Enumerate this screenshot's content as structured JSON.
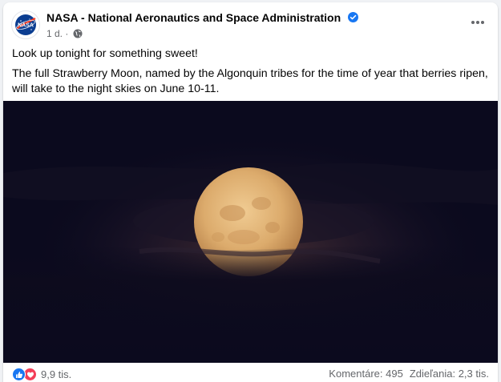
{
  "post": {
    "author": "NASA - National Aeronautics and Space Administration",
    "avatar_text": "NASA",
    "time": "1 d.",
    "time_sep": "·",
    "icons": {
      "verified": "verified-badge-icon",
      "audience": "globe-icon",
      "more": "more-options-icon"
    },
    "text_line1": "Look up tonight for something sweet!",
    "text_line2": "The full Strawberry Moon, named by the Algonquin tribes for the time of year that berries ripen, will take to the night skies on June 10-11."
  },
  "footer": {
    "reaction_count": "9,9 tis.",
    "comments": "Komentáre: 495",
    "shares": "Zdieľania: 2,3 tis."
  },
  "colors": {
    "verified": "#1877f2",
    "like": "#1877f2",
    "love": "#f33e58",
    "photo_sky": "#0b0a1e",
    "moon": "#e2b57c"
  }
}
